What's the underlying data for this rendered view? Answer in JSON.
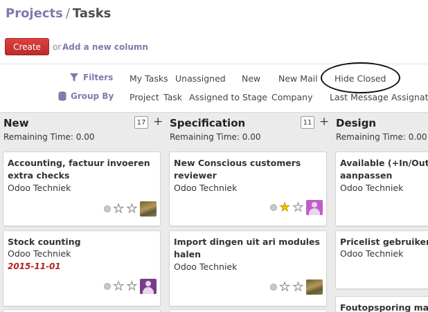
{
  "breadcrumb": {
    "parent": "Projects",
    "separator": "/",
    "current": "Tasks"
  },
  "toolbar": {
    "create_label": "Create",
    "or_text": "or",
    "add_column_label": "Add a new column"
  },
  "filters": {
    "filters_label": "Filters",
    "filter_options": [
      "My Tasks",
      "Unassigned",
      "New",
      "New Mail",
      "Hide Closed"
    ],
    "group_by_label": "Group By",
    "group_options": [
      "Project",
      "Task",
      "Assigned to",
      "Stage",
      "Company",
      "Last Message",
      "Assignatio"
    ]
  },
  "columns": [
    {
      "title": "New",
      "count": "17",
      "add": "+",
      "remaining": "Remaining Time: 0.00",
      "cards": [
        {
          "title": "Accounting, factuur invoeren extra checks",
          "subtitle": "Odoo Techniek",
          "date": "",
          "starred": false,
          "avatar": "landscape-photo"
        },
        {
          "title": "Stock counting",
          "subtitle": "Odoo Techniek",
          "date": "2015-11-01",
          "starred": false,
          "avatar": "person-silhouette-purple"
        }
      ]
    },
    {
      "title": "Specification",
      "count": "11",
      "add": "+",
      "remaining": "Remaining Time: 0.00",
      "cards": [
        {
          "title": "New Conscious customers reviewer",
          "subtitle": "Odoo Techniek",
          "date": "",
          "starred": true,
          "avatar": "person-silhouette-pink"
        },
        {
          "title": "Import dingen uit ari modules halen",
          "subtitle": "Odoo Techniek",
          "date": "",
          "starred": false,
          "avatar": "landscape-photo"
        }
      ]
    },
    {
      "title": "Design",
      "remaining": "Remaining Time: 0.00",
      "cards": [
        {
          "title": "Available (+In/Outgoi aanpassen",
          "subtitle": "Odoo Techniek"
        },
        {
          "title": "Pricelist gebruiken b",
          "subtitle": "Odoo Techniek"
        },
        {
          "title": "Foutopsporing make"
        }
      ]
    }
  ],
  "colors": {
    "accent": "#7c7bad",
    "create_button": "#d63939",
    "board_bg": "#ebebeb",
    "date_red": "#b22020",
    "star_gold": "#f5c400"
  }
}
